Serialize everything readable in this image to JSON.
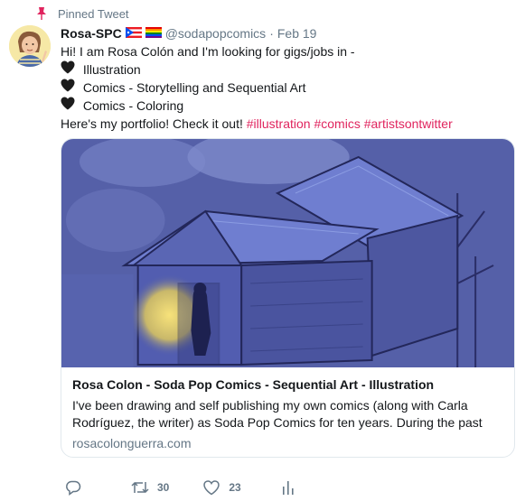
{
  "pinned": {
    "label": "Pinned Tweet"
  },
  "tweet": {
    "display_name": "Rosa-SPC",
    "handle": "@sodapopcomics",
    "date": "Feb 19",
    "separator": "·",
    "line1": "Hi! I am Rosa Colón and I'm looking for gigs/jobs in -",
    "items": [
      "Illustration",
      "Comics - Storytelling and Sequential Art",
      "Comics - Coloring"
    ],
    "portfolio_text": "Here's my portfolio! Check it out!",
    "hashtags": [
      "#illustration",
      "#comics",
      "#artistsontwitter"
    ]
  },
  "card": {
    "title": "Rosa Colon - Soda Pop Comics - Sequential Art - Illustration",
    "desc_line1": "I've been drawing and self publishing my own comics (along with Carla",
    "desc_line2": "Rodríguez, the writer) as Soda Pop Comics for ten years. During the past",
    "domain": "rosacolonguerra.com"
  },
  "actions": {
    "retweets": "30",
    "likes": "23"
  },
  "colors": {
    "hashtag": "#e0245e",
    "muted": "#657786",
    "card_border": "#e1e8ed",
    "illustration_bg": "#5560a8"
  },
  "icons": [
    "pin-icon",
    "puerto-rico-flag-icon",
    "rainbow-flag-icon",
    "black-heart-icon",
    "reply-icon",
    "retweet-icon",
    "like-icon",
    "analytics-icon"
  ]
}
